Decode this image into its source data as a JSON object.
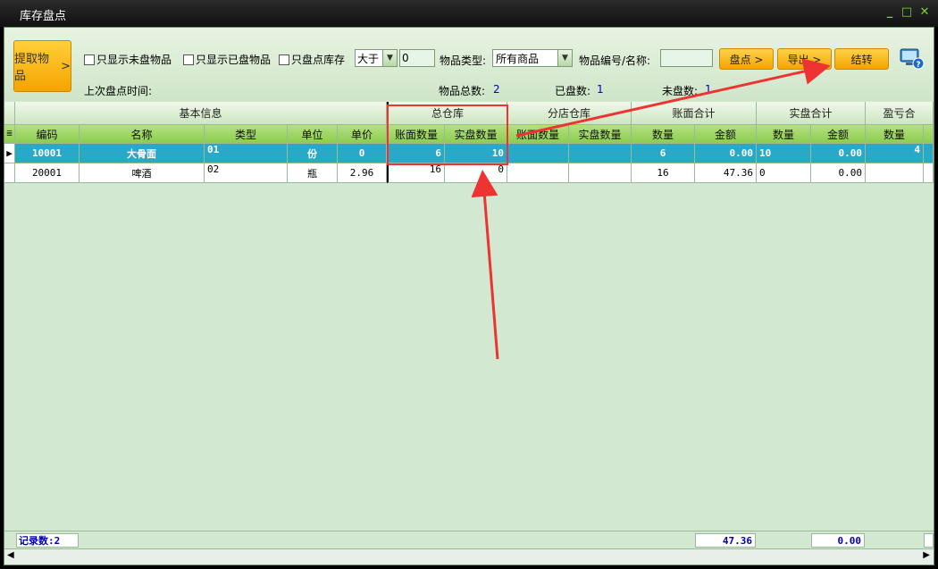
{
  "window": {
    "title": "库存盘点",
    "controls": [
      "_",
      "□",
      "✕"
    ]
  },
  "toolbar": {
    "fetch_button": "提取物品",
    "fetch_arrow": ">",
    "chk_unchecked_only": "只显示未盘物品",
    "chk_checked_only": "只显示已盘物品",
    "chk_stock_only": "只盘点库存",
    "compare_op": "大于",
    "compare_value": "0",
    "type_label": "物品类型:",
    "type_value": "所有商品",
    "code_label": "物品编号/名称:",
    "code_value": "",
    "btn_check": "盘点 >",
    "btn_export": "导出 >",
    "btn_close": "结转",
    "last_time_label": "上次盘点时间:",
    "total_label": "物品总数:",
    "total_value": "2",
    "checked_label": "已盘数:",
    "checked_value": "1",
    "unchecked_label": "未盘数:",
    "unchecked_value": "1"
  },
  "grid": {
    "groups": {
      "basic": "基本信息",
      "main_wh": "总仓库",
      "branch_wh": "分店仓库",
      "book_total": "账面合计",
      "real_total": "实盘合计",
      "profit_loss": "盈亏合"
    },
    "columns": {
      "code": "编码",
      "name": "名称",
      "type": "类型",
      "unit": "单位",
      "price": "单价",
      "main_book": "账面数量",
      "main_real": "实盘数量",
      "branch_book": "账面数量",
      "branch_real": "实盘数量",
      "book_qty": "数量",
      "book_amt": "金额",
      "real_qty": "数量",
      "real_amt": "金额",
      "pl_qty": "数量"
    },
    "rows": [
      {
        "code": "10001",
        "name": "大骨面",
        "type": "01",
        "unit": "份",
        "price": "0",
        "main_book": "6",
        "main_real": "10",
        "branch_book": "",
        "branch_real": "",
        "book_qty": "6",
        "book_amt": "0.00",
        "real_qty": "10",
        "real_amt": "0.00",
        "pl_qty": "4"
      },
      {
        "code": "20001",
        "name": "啤酒",
        "type": "02",
        "unit": "瓶",
        "price": "2.96",
        "main_book": "16",
        "main_real": "0",
        "branch_book": "",
        "branch_real": "",
        "book_qty": "16",
        "book_amt": "47.36",
        "real_qty": "0",
        "real_amt": "0.00",
        "pl_qty": ""
      }
    ]
  },
  "footer": {
    "record_count": "记录数:2",
    "book_amt_sum": "47.36",
    "real_amt_sum": "0.00"
  },
  "colors": {
    "accent_orange": "#f5a400",
    "selected_row": "#29a8c8",
    "annotation_red": "#ee3333",
    "bg_green": "#d2e8d0"
  }
}
